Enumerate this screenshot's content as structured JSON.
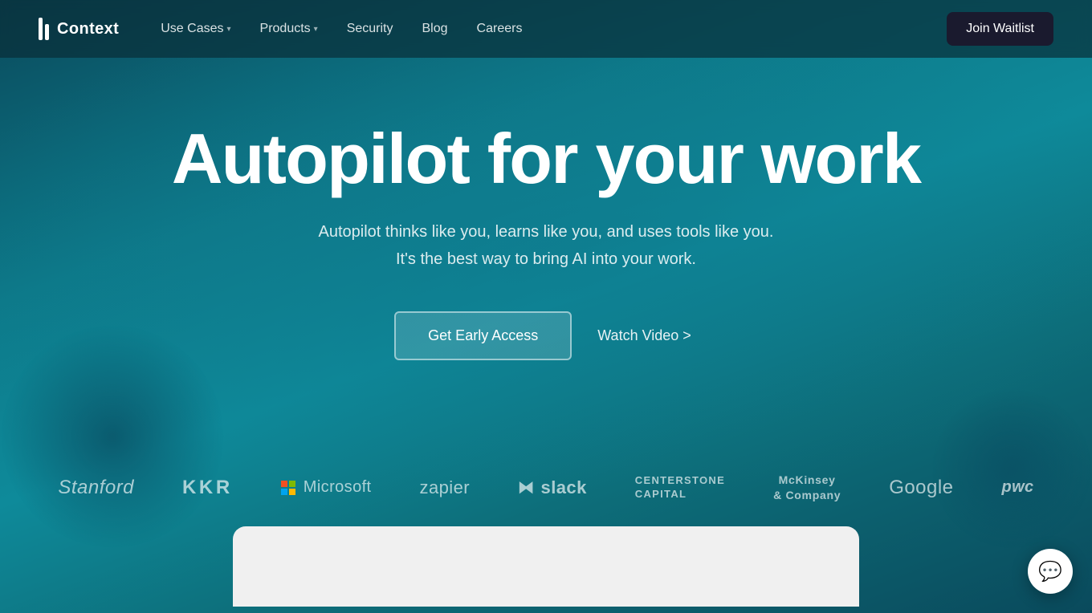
{
  "nav": {
    "logo_text": "Context",
    "links": [
      {
        "label": "Use Cases",
        "has_dropdown": true
      },
      {
        "label": "Products",
        "has_dropdown": true
      },
      {
        "label": "Security",
        "has_dropdown": false
      },
      {
        "label": "Blog",
        "has_dropdown": false
      },
      {
        "label": "Careers",
        "has_dropdown": false
      }
    ],
    "cta_label": "Join Waitlist"
  },
  "hero": {
    "title": "Autopilot for your work",
    "subtitle_line1": "Autopilot thinks like you, learns like you, and uses tools like you.",
    "subtitle_line2": "It's the best way to bring AI into your work.",
    "cta_primary": "Get Early Access",
    "cta_secondary": "Watch Video >"
  },
  "logos": [
    {
      "name": "stanford",
      "text": "Stanford",
      "class": "stanford"
    },
    {
      "name": "kkr",
      "text": "KKR",
      "class": "kkr"
    },
    {
      "name": "microsoft",
      "text": "Microsoft",
      "class": "microsoft",
      "has_grid": true
    },
    {
      "name": "zapier",
      "text": "zapier",
      "class": "zapier"
    },
    {
      "name": "slack",
      "text": "slack",
      "class": "slack",
      "has_hash": true
    },
    {
      "name": "centerstone",
      "text": "CENTERSTONE\nCAPITAL",
      "class": "centerstone"
    },
    {
      "name": "mckinsey",
      "text": "McKinsey\n& Company",
      "class": "mckinsey"
    },
    {
      "name": "google",
      "text": "Google",
      "class": "google"
    },
    {
      "name": "pwc",
      "text": "pwc",
      "class": "pwc"
    }
  ],
  "chat": {
    "icon": "💬"
  }
}
